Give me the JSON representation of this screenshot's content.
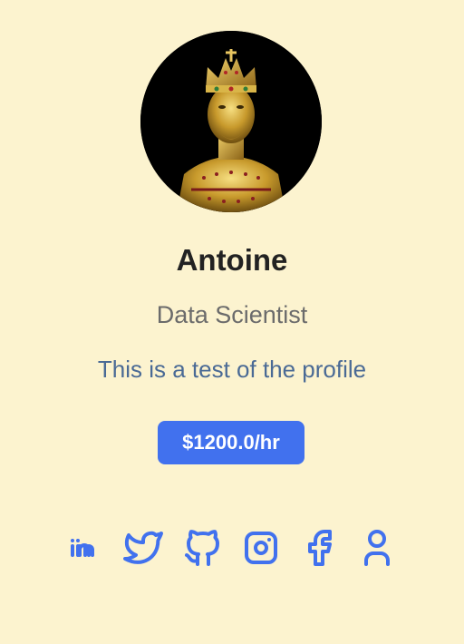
{
  "profile": {
    "avatar_alt": "Antoine",
    "name": "Antoine",
    "title": "Data Scientist",
    "bio": "This is a test of the profile",
    "rate": "$1200.0/hr"
  },
  "socials": [
    {
      "icon": "linkedin-icon"
    },
    {
      "icon": "twitter-icon"
    },
    {
      "icon": "github-icon"
    },
    {
      "icon": "instagram-icon"
    },
    {
      "icon": "facebook-icon"
    },
    {
      "icon": "user-icon"
    }
  ],
  "colors": {
    "background": "#fcf3cf",
    "accent": "#4171ee",
    "name": "#222222",
    "title": "#6b6b6b",
    "bio": "#4a6a95"
  }
}
